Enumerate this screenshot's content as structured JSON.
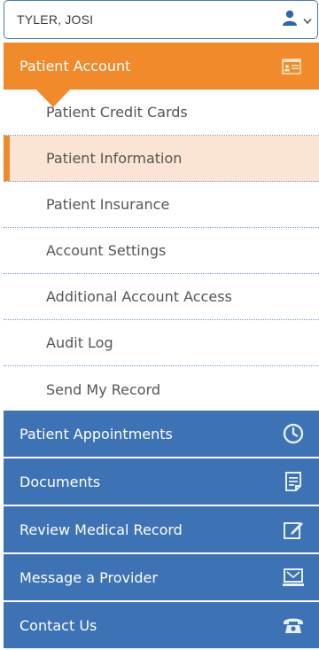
{
  "user_select": {
    "name": "TYLER, JOSI",
    "icon": "user-icon"
  },
  "patient_account": {
    "label": "Patient Account",
    "icon": "id-card-icon"
  },
  "sub_items": [
    {
      "label": "Patient Credit Cards"
    },
    {
      "label": "Patient Information"
    },
    {
      "label": "Patient Insurance"
    },
    {
      "label": "Account Settings"
    },
    {
      "label": "Additional Account Access"
    },
    {
      "label": "Audit Log"
    },
    {
      "label": "Send My Record"
    }
  ],
  "main_items": [
    {
      "label": "Patient Appointments",
      "icon": "clock-icon"
    },
    {
      "label": "Documents",
      "icon": "document-icon"
    },
    {
      "label": "Review Medical Record",
      "icon": "edit-record-icon"
    },
    {
      "label": "Message a Provider",
      "icon": "message-icon"
    },
    {
      "label": "Contact Us",
      "icon": "phone-icon"
    }
  ],
  "colors": {
    "orange": "#f08a2b",
    "blue": "#3d72b5",
    "active_bg": "#fbe4d3"
  }
}
